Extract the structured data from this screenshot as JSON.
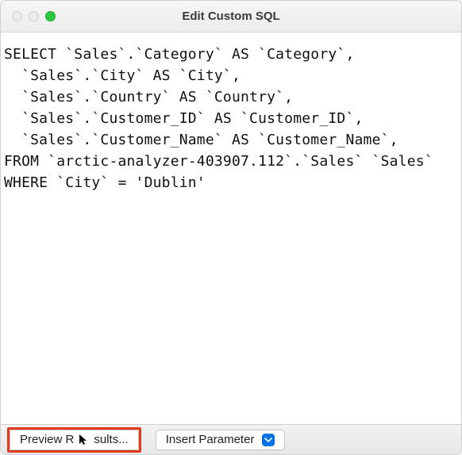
{
  "window": {
    "title": "Edit Custom SQL"
  },
  "sql": {
    "lines": [
      "SELECT `Sales`.`Category` AS `Category`,",
      "  `Sales`.`City` AS `City`,",
      "  `Sales`.`Country` AS `Country`,",
      "  `Sales`.`Customer_ID` AS `Customer_ID`,",
      "  `Sales`.`Customer_Name` AS `Customer_Name`,",
      "FROM `arctic-analyzer-403907.112`.`Sales` `Sales`",
      "WHERE `City` = 'Dublin'"
    ]
  },
  "toolbar": {
    "preview_prefix": "Preview R",
    "preview_suffix": "sults...",
    "insert_parameter_label": "Insert Parameter"
  },
  "icons": {
    "cursor": "cursor-arrow-icon",
    "dropdown": "chevron-down-icon"
  },
  "colors": {
    "highlight": "#e03a1e",
    "accent": "#0071e3",
    "traffic_green": "#28c840"
  }
}
